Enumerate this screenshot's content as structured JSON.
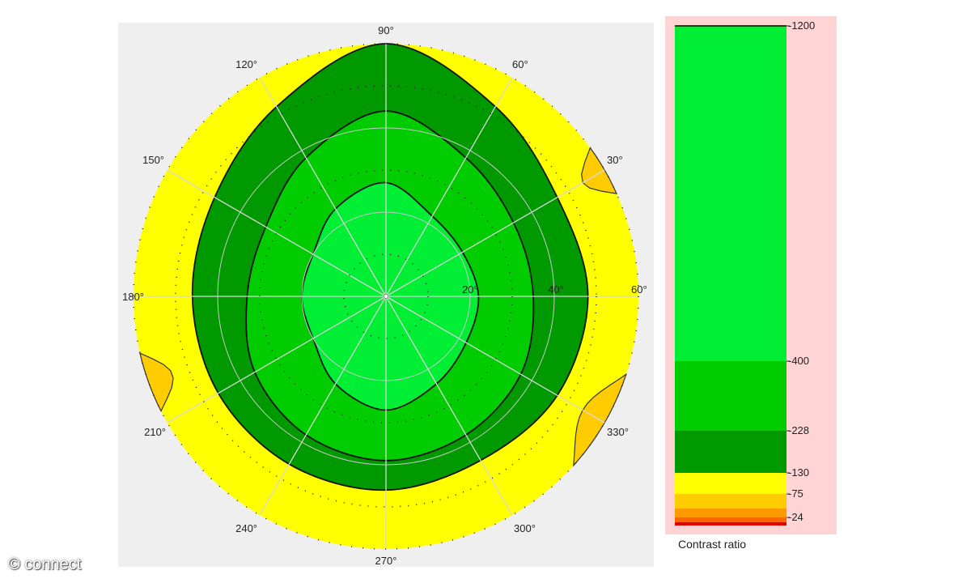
{
  "chart_data": {
    "type": "polar-contour",
    "angle_ticks": [
      "90°",
      "60°",
      "30°",
      "60°",
      "330°",
      "300°",
      "270°",
      "240°",
      "210°",
      "180°",
      "150°",
      "120°"
    ],
    "radial_ticks": [
      "20°",
      "40°"
    ],
    "r_max_deg": 60,
    "levels": [
      {
        "value": 400,
        "color": "#00ee33"
      },
      {
        "value": 228,
        "color": "#00cc00"
      },
      {
        "value": 130,
        "color": "#009900"
      },
      {
        "value": 75,
        "color": "#ffff00"
      },
      {
        "value": 24,
        "color": "#ffcc00"
      }
    ],
    "contours": [
      {
        "level": 400,
        "label": "-400",
        "radii_by_angle_0_to_330_step30": [
          22,
          21,
          22,
          27,
          24,
          20,
          20,
          20,
          24,
          27,
          24,
          22
        ]
      },
      {
        "level": 228,
        "label": "-228",
        "radii_by_angle_0_to_330_step30": [
          35,
          35,
          38,
          44,
          38,
          33,
          33,
          36,
          38,
          39,
          38,
          37
        ]
      },
      {
        "level": 130,
        "label": "-130",
        "radii_by_angle_0_to_330_step30": [
          48,
          47,
          52,
          60,
          52,
          47,
          46,
          46,
          46,
          46,
          45,
          47
        ]
      },
      {
        "level": 75,
        "label": "-75",
        "radii_by_angle_0_to_330_step30": [
          60,
          60,
          60,
          60,
          60,
          60,
          60,
          60,
          60,
          60,
          60,
          60
        ]
      }
    ],
    "low_regions": [
      {
        "level": 24,
        "location": "left, around 195°–205°"
      },
      {
        "level": 24,
        "location": "right, around 320°–340°"
      },
      {
        "level": 24,
        "location": "right edge, around 25°–35°"
      }
    ],
    "colorbar": {
      "title": "Contrast ratio",
      "tick_labels": [
        "-1200",
        "-400",
        "-228",
        "-130",
        "-75",
        "-24"
      ],
      "bands": [
        {
          "from": 400,
          "to": 1200,
          "color": "#00ee33"
        },
        {
          "from": 228,
          "to": 400,
          "color": "#00cc00"
        },
        {
          "from": 130,
          "to": 228,
          "color": "#009900"
        },
        {
          "from": 75,
          "to": 130,
          "color": "#ffff00"
        },
        {
          "from": 50,
          "to": 75,
          "color": "#ffcc00"
        },
        {
          "from": 24,
          "to": 50,
          "color": "#ff9900"
        },
        {
          "from": 10,
          "to": 24,
          "color": "#ff6600"
        },
        {
          "from": 0,
          "to": 10,
          "color": "#dd0000"
        }
      ]
    }
  },
  "watermark": "© connect"
}
